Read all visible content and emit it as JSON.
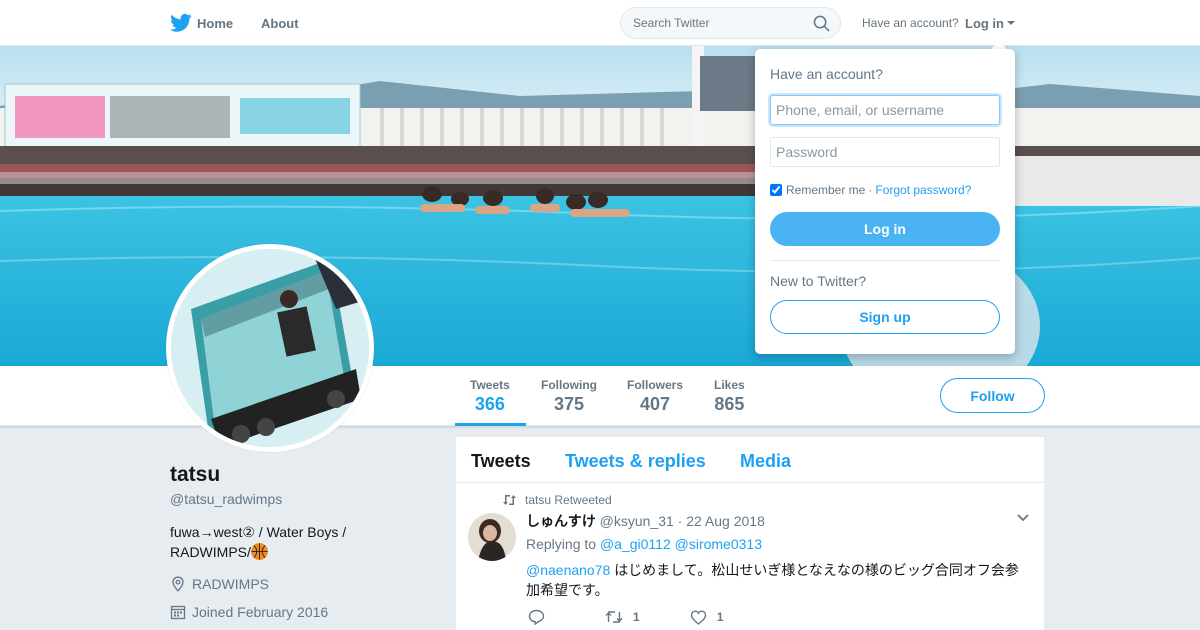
{
  "nav": {
    "home_label": "Home",
    "about_label": "About",
    "search_placeholder": "Search Twitter",
    "have_account_text": "Have an account?",
    "login_label": "Log in"
  },
  "profile": {
    "name": "tatsu",
    "handle": "@tatsu_radwimps",
    "bio": "fuwa→west② / Water Boys / RADWIMPS/",
    "location": "RADWIMPS",
    "joined": "Joined February 2016"
  },
  "stats": [
    {
      "label": "Tweets",
      "value": "366"
    },
    {
      "label": "Following",
      "value": "375"
    },
    {
      "label": "Followers",
      "value": "407"
    },
    {
      "label": "Likes",
      "value": "865"
    }
  ],
  "follow_label": "Follow",
  "timeline": {
    "tabs": [
      {
        "label": "Tweets"
      },
      {
        "label": "Tweets & replies"
      },
      {
        "label": "Media"
      }
    ],
    "tweet": {
      "retweeted_by": "tatsu Retweeted",
      "fullname": "しゅんすけ",
      "username": "@ksyun_31",
      "separator": "·",
      "date": "22 Aug 2018",
      "replying_to_label": "Replying to",
      "mention_1": "@a_gi0112",
      "mention_2": "@sirome0313",
      "text_mention": "@naenano78",
      "text_body": "はじめまして。松山せいぎ様となえなの様のビッグ合同オフ会参加希望です。",
      "retweet_count": "1",
      "like_count": "1"
    }
  },
  "login_dropdown": {
    "heading": "Have an account?",
    "username_placeholder": "Phone, email, or username",
    "password_placeholder": "Password",
    "remember_label": "Remember me",
    "separator": "·",
    "forgot_label": "Forgot password?",
    "login_button": "Log in",
    "new_heading": "New to Twitter?",
    "signup_button": "Sign up"
  },
  "colors": {
    "accent": "#1da1f2",
    "login_button": "#4ab3f4",
    "background": "#e6ecf0"
  }
}
